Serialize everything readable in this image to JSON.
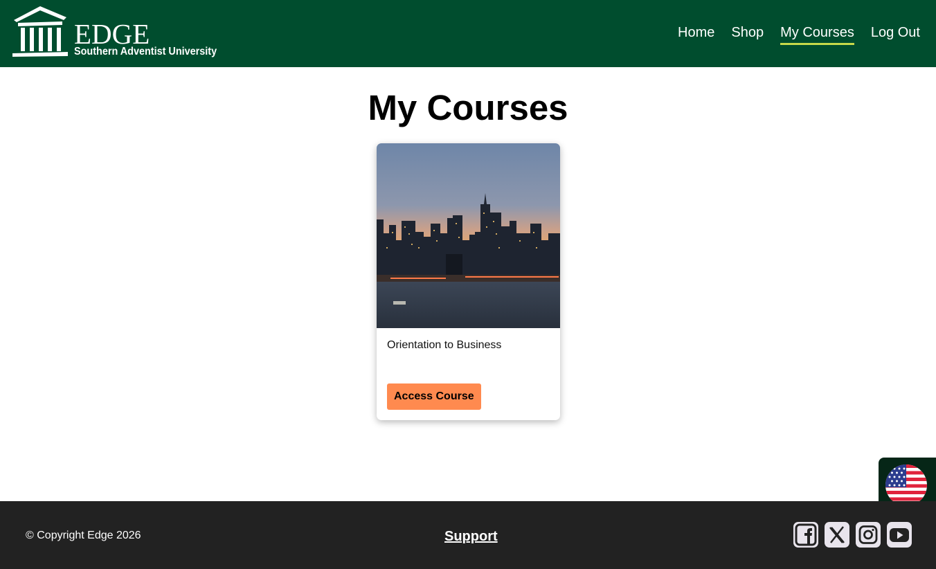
{
  "brand": {
    "name": "EDGE",
    "subtitle": "Southern Adventist University",
    "logo_icon": "building-columns-icon"
  },
  "nav": {
    "items": [
      {
        "label": "Home",
        "active": false
      },
      {
        "label": "Shop",
        "active": false
      },
      {
        "label": "My Courses",
        "active": true
      },
      {
        "label": "Log Out",
        "active": false
      }
    ],
    "active_underline_color": "#c8d94a"
  },
  "main": {
    "title": "My Courses",
    "courses": [
      {
        "title": "Orientation to Business",
        "button_label": "Access Course",
        "image_icon": "city-skyline-image"
      }
    ]
  },
  "language": {
    "flag_icon": "us-flag-icon"
  },
  "footer": {
    "copyright": "© Copyright Edge 2026",
    "support_label": "Support",
    "socials": [
      "facebook-icon",
      "x-twitter-icon",
      "instagram-icon",
      "youtube-icon"
    ]
  },
  "colors": {
    "header_bg": "#004d2e",
    "footer_bg": "#222222",
    "button_bg": "#ff8a4f"
  }
}
